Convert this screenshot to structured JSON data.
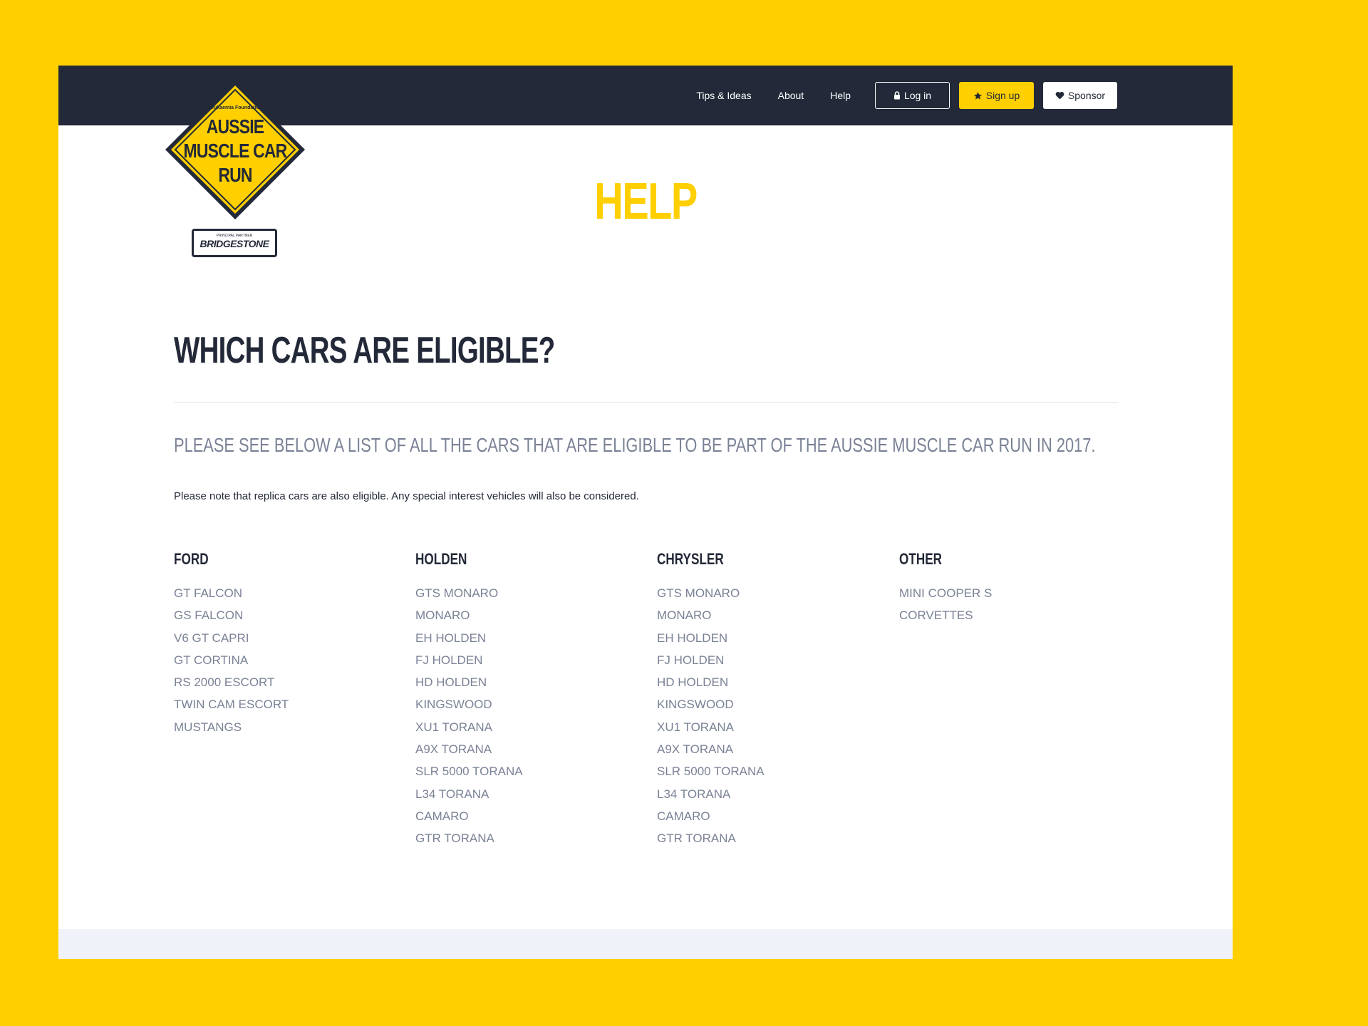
{
  "nav": {
    "links": [
      "Tips & Ideas",
      "About",
      "Help"
    ],
    "login_label": "Log in",
    "signup_label": "Sign up",
    "sponsor_label": "Sponsor"
  },
  "logo": {
    "foundation": "Leukaemia Foundation",
    "line1": "AUSSIE",
    "line2": "MUSCLE CAR",
    "line3": "RUN",
    "partner_label": "PRINCIPAL PARTNER",
    "partner_name": "BRIDGESTONE"
  },
  "page": {
    "title": "HELP",
    "heading": "WHICH CARS ARE ELIGIBLE?",
    "subheading": "PLEASE SEE BELOW A LIST OF ALL THE CARS THAT ARE ELIGIBLE TO BE PART OF THE AUSSIE MUSCLE CAR RUN IN 2017.",
    "note": "Please note that replica cars are also eligible. Any special interest vehicles will also be considered."
  },
  "columns": [
    {
      "heading": "FORD",
      "items": [
        "GT FALCON",
        "GS FALCON",
        "V6 GT CAPRI",
        "GT CORTINA",
        "RS 2000 ESCORT",
        "TWIN CAM ESCORT",
        "MUSTANGS"
      ]
    },
    {
      "heading": "HOLDEN",
      "items": [
        "GTS MONARO",
        "MONARO",
        "EH HOLDEN",
        "FJ HOLDEN",
        "HD HOLDEN",
        "KINGSWOOD",
        "XU1 TORANA",
        "A9X TORANA",
        "SLR 5000 TORANA",
        "L34 TORANA",
        "CAMARO",
        "GTR TORANA"
      ]
    },
    {
      "heading": "CHRYSLER",
      "items": [
        "GTS MONARO",
        "MONARO",
        "EH HOLDEN",
        "FJ HOLDEN",
        "HD HOLDEN",
        "KINGSWOOD",
        "XU1 TORANA",
        "A9X TORANA",
        "SLR 5000 TORANA",
        "L34 TORANA",
        "CAMARO",
        "GTR TORANA"
      ]
    },
    {
      "heading": "OTHER",
      "items": [
        "MINI COOPER S",
        "CORVETTES"
      ]
    }
  ],
  "colors": {
    "brand_yellow": "#FFCF00",
    "navy": "#232938",
    "muted_text": "#7a8296"
  }
}
